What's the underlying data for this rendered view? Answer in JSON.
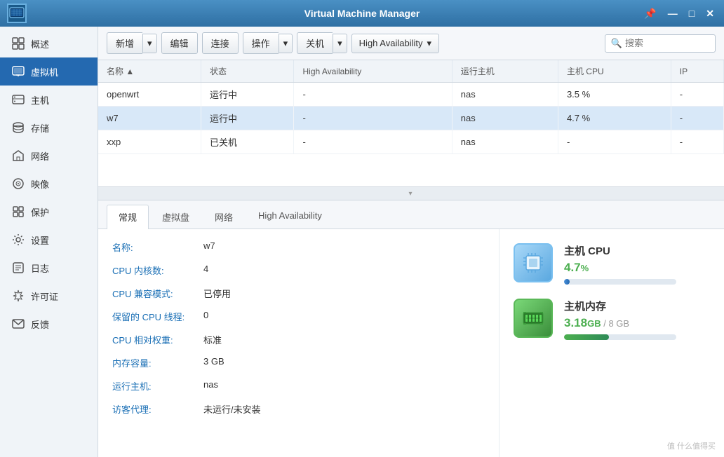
{
  "app": {
    "title": "Virtual Machine Manager",
    "logo_text": "VMM"
  },
  "titlebar_controls": {
    "pin": "📌",
    "minimize": "—",
    "maximize": "□",
    "close": "✕"
  },
  "sidebar": {
    "items": [
      {
        "id": "overview",
        "label": "概述",
        "icon": "≡"
      },
      {
        "id": "vm",
        "label": "虚拟机",
        "icon": "⊟",
        "active": true
      },
      {
        "id": "host",
        "label": "主机",
        "icon": "🖥"
      },
      {
        "id": "storage",
        "label": "存储",
        "icon": "💾"
      },
      {
        "id": "network",
        "label": "网络",
        "icon": "🏠"
      },
      {
        "id": "image",
        "label": "映像",
        "icon": "💿"
      },
      {
        "id": "protect",
        "label": "保护",
        "icon": "⊞"
      },
      {
        "id": "settings",
        "label": "设置",
        "icon": "⚙"
      },
      {
        "id": "log",
        "label": "日志",
        "icon": "≡"
      },
      {
        "id": "license",
        "label": "许可证",
        "icon": "🔑"
      },
      {
        "id": "feedback",
        "label": "反馈",
        "icon": "✉"
      }
    ]
  },
  "toolbar": {
    "add_label": "新增",
    "edit_label": "编辑",
    "connect_label": "连接",
    "action_label": "操作",
    "shutdown_label": "关机",
    "ha_label": "High Availability",
    "search_placeholder": "搜索"
  },
  "vm_table": {
    "columns": [
      "名称",
      "状态",
      "High Availability",
      "运行主机",
      "主机 CPU",
      "IP"
    ],
    "rows": [
      {
        "name": "openwrt",
        "status": "运行中",
        "ha": "-",
        "host": "nas",
        "cpu": "3.5 %",
        "ip": "-",
        "selected": false
      },
      {
        "name": "w7",
        "status": "运行中",
        "ha": "-",
        "host": "nas",
        "cpu": "4.7 %",
        "ip": "-",
        "selected": true
      },
      {
        "name": "xxp",
        "status": "已关机",
        "ha": "-",
        "host": "nas",
        "cpu": "-",
        "ip": "-",
        "selected": false
      }
    ]
  },
  "detail_tabs": [
    {
      "id": "general",
      "label": "常规",
      "active": true
    },
    {
      "id": "disk",
      "label": "虚拟盘"
    },
    {
      "id": "network",
      "label": "网络"
    },
    {
      "id": "ha",
      "label": "High Availability"
    }
  ],
  "detail_fields": [
    {
      "label": "名称:",
      "value": "w7"
    },
    {
      "label": "CPU 内核数:",
      "value": "4"
    },
    {
      "label": "CPU 兼容模式:",
      "value": "已停用"
    },
    {
      "label": "保留的 CPU 线程:",
      "value": "0"
    },
    {
      "label": "CPU 相对权重:",
      "value": "标准"
    },
    {
      "label": "内存容量:",
      "value": "3 GB"
    },
    {
      "label": "运行主机:",
      "value": "nas"
    },
    {
      "label": "访客代理:",
      "value": "未运行/未安装"
    }
  ],
  "resources": {
    "cpu": {
      "title": "主机 CPU",
      "value": "4.7",
      "unit": "%",
      "progress": 4.7,
      "max": 100
    },
    "memory": {
      "title": "主机内存",
      "used": "3.18",
      "total": "8",
      "unit": "GB",
      "progress": 39.75
    }
  },
  "watermark": "值 什么值得买"
}
